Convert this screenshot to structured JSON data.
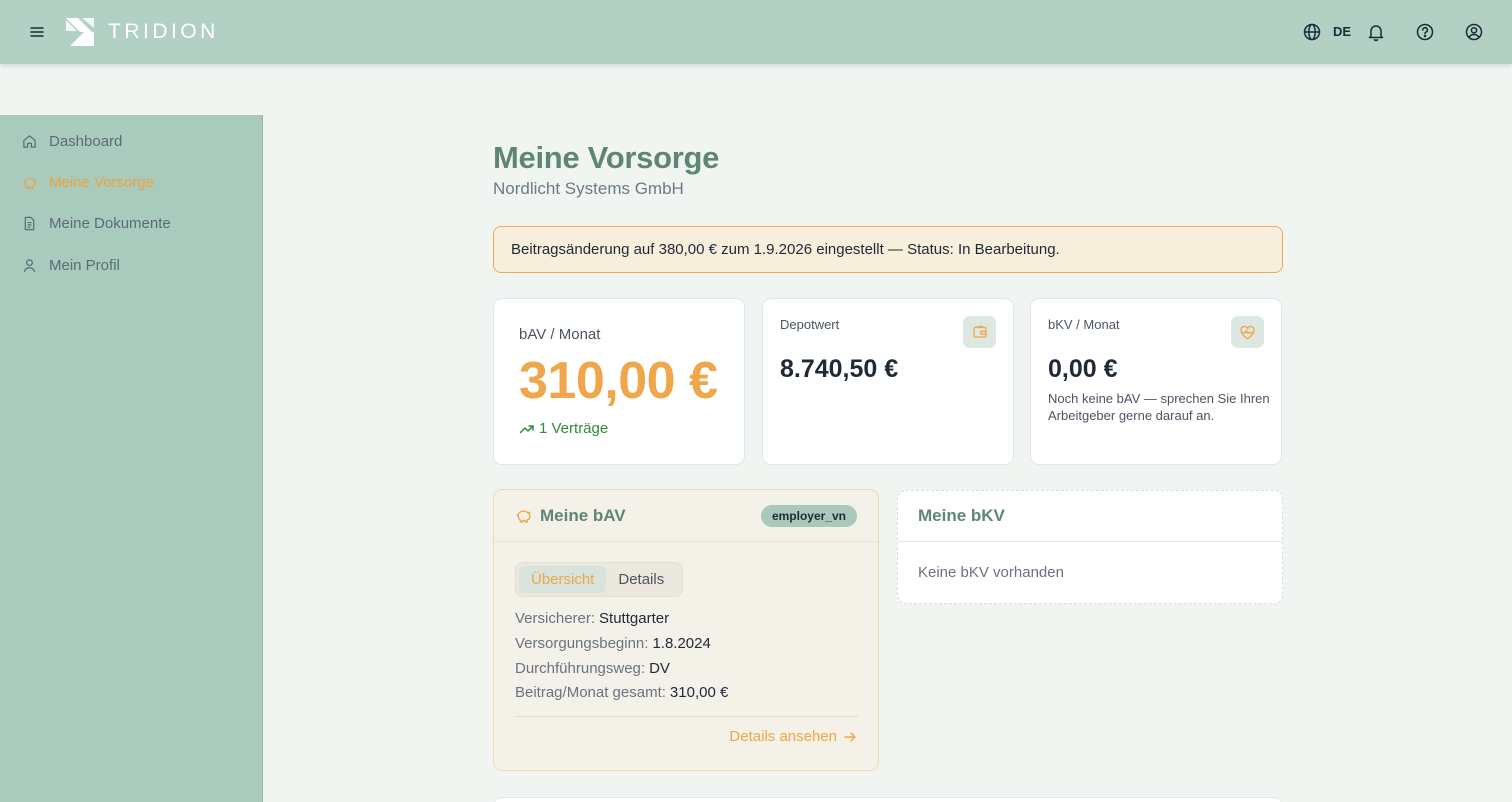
{
  "header": {
    "brand": "TRIDION",
    "language": "DE",
    "icons": [
      "menu-icon",
      "globe-icon",
      "bell-icon",
      "help-icon",
      "user-icon"
    ]
  },
  "sidebar": {
    "items": [
      {
        "label": "Dashboard",
        "icon": "home-icon",
        "active": false
      },
      {
        "label": "Meine Vorsorge",
        "icon": "piggy-bank-icon",
        "active": true
      },
      {
        "label": "Meine Dokumente",
        "icon": "document-icon",
        "active": false
      },
      {
        "label": "Mein Profil",
        "icon": "user-icon",
        "active": false
      }
    ]
  },
  "page": {
    "title": "Meine Vorsorge",
    "subtitle": "Nordlicht Systems GmbH"
  },
  "notice": {
    "text": "Beitragsänderung auf 380,00 € zum 1.9.2026 eingestellt — Status: In Bearbeitung."
  },
  "stats": {
    "bav": {
      "label": "bAV / Monat",
      "value": "310,00 €",
      "trend": "1 Verträge"
    },
    "depot": {
      "label": "Depotwert",
      "value": "8.740,50 €"
    },
    "bkv": {
      "label": "bKV / Monat",
      "value": "0,00 €",
      "note": "Noch keine bAV — sprechen Sie Ihren Arbeitgeber gerne darauf an."
    }
  },
  "bav_panel": {
    "title": "Meine bAV",
    "badge": "employer_vn",
    "tabs": [
      "Übersicht",
      "Details"
    ],
    "rows": [
      {
        "key": "Versicherer:",
        "value": "Stuttgarter"
      },
      {
        "key": "Versorgungsbeginn:",
        "value": "1.8.2024"
      },
      {
        "key": "Durchführungsweg:",
        "value": "DV"
      },
      {
        "key": "Beitrag/Monat gesamt:",
        "value": "310,00 €"
      }
    ],
    "link": "Details ansehen"
  },
  "bkv_panel": {
    "title": "Meine bKV",
    "empty": "Keine bKV vorhanden"
  },
  "colors": {
    "header": "#b2d0c4",
    "sidebar": "#a8cbbd",
    "accent": "#f0a64a",
    "heading": "#5e8576",
    "trend": "#2f8a3a"
  }
}
